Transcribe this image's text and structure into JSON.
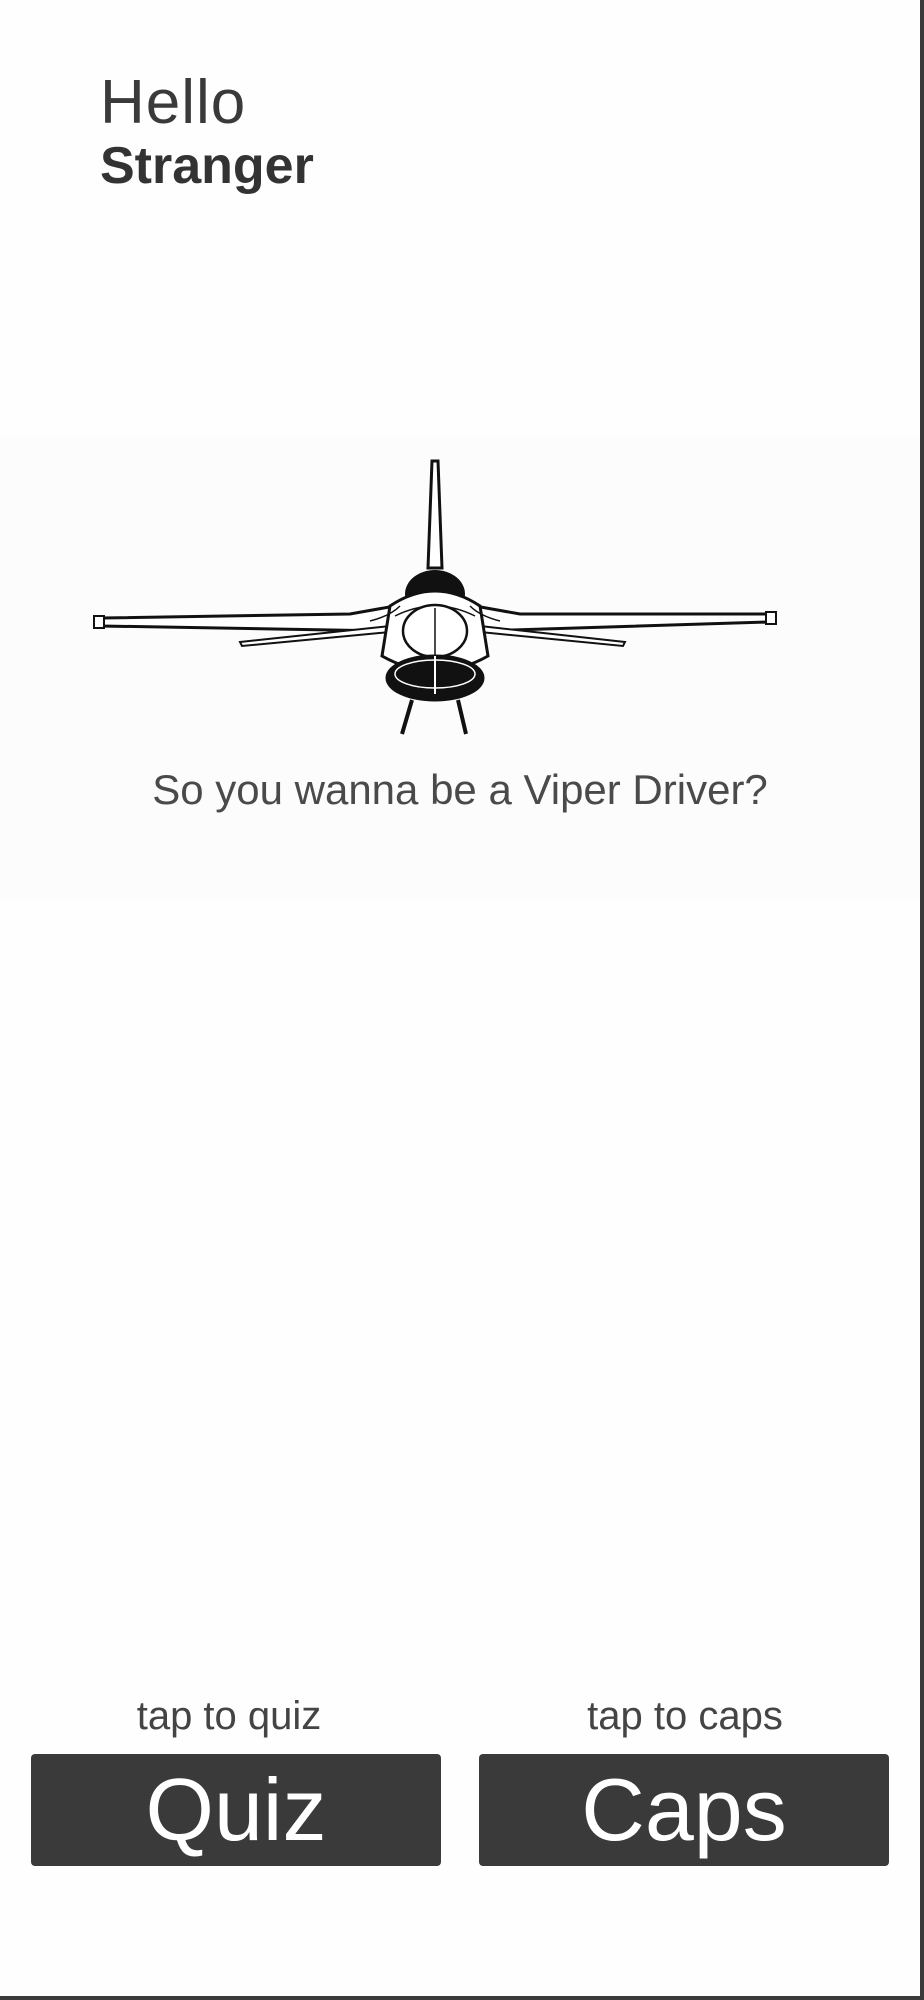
{
  "greeting": {
    "hello": "Hello",
    "name": "Stranger"
  },
  "hero": {
    "image_icon": "f16-jet-front-view-icon",
    "tagline": "So you wanna be a Viper Driver?"
  },
  "actions": {
    "quiz": {
      "hint": "tap to quiz",
      "label": "Quiz"
    },
    "caps": {
      "hint": "tap to caps",
      "label": "Caps"
    }
  },
  "colors": {
    "button_bg": "#3a3a3a",
    "button_text": "#ffffff",
    "background": "#fefefe",
    "text": "#333333"
  }
}
